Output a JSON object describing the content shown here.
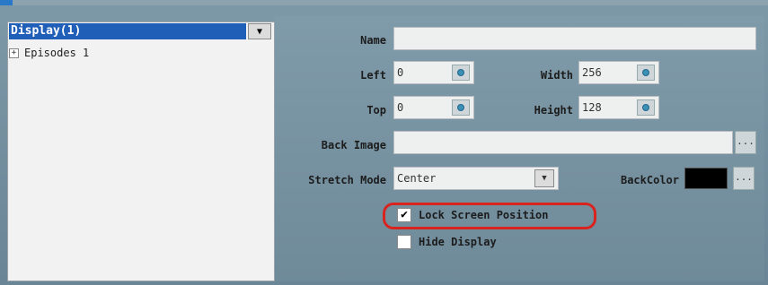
{
  "left": {
    "combo_selected": "Display(1)",
    "tree_item": "Episodes 1",
    "expand_glyph": "+"
  },
  "props": {
    "name_label": "Name",
    "name_value": "",
    "left_label": "Left",
    "left_value": "0",
    "width_label": "Width",
    "width_value": "256",
    "top_label": "Top",
    "top_value": "0",
    "height_label": "Height",
    "height_value": "128",
    "back_image_label": "Back Image",
    "back_image_value": "",
    "browse_label": "...",
    "stretch_label": "Stretch Mode",
    "stretch_value": "Center",
    "backcolor_label": "BackColor",
    "backcolor_color": "#000000",
    "lock_label": "Lock Screen Position",
    "lock_checked": true,
    "hide_label": "Hide Display",
    "hide_checked": false
  },
  "icons": {
    "dropdown": "chevron-down-icon",
    "spin": "spin-icon",
    "check": "check-icon"
  },
  "highlight_color": "#d8231f"
}
